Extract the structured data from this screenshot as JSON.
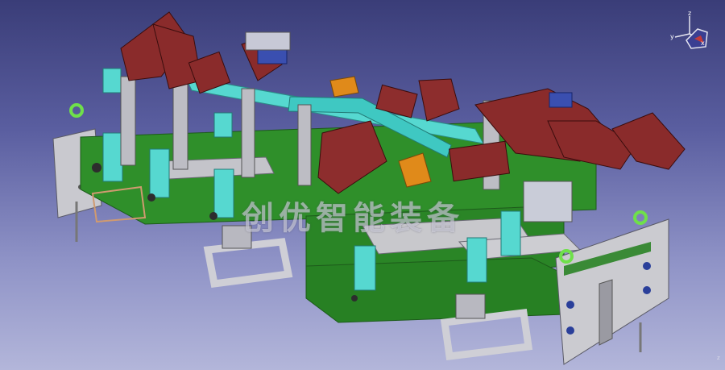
{
  "viewer": {
    "watermark_text": "创优智能装备",
    "compass": {
      "axis_x": "x",
      "axis_y": "y",
      "axis_z": "z"
    },
    "corner_mark": "z"
  },
  "colors": {
    "background_top": "#3a3d78",
    "background_bottom": "#b3b6da",
    "base_green": "#2f8f2a",
    "plate_grey": "#c8c8cc",
    "cylinder_cyan": "#56d8d0",
    "clamp_red": "#8a2b2b",
    "accent_orange": "#e08a1a",
    "accent_blue": "#3a4fb0"
  }
}
